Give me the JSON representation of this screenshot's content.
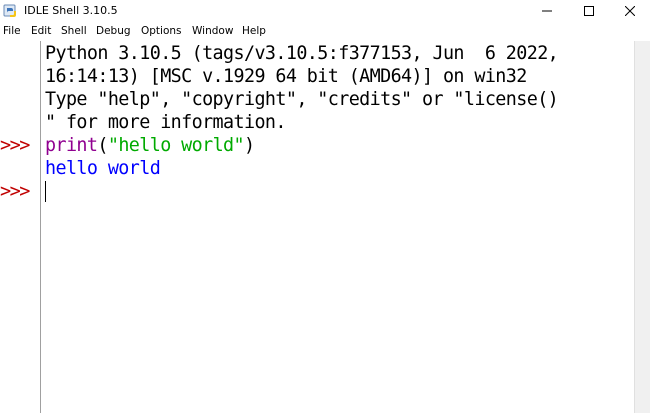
{
  "window": {
    "title": "IDLE Shell 3.10.5",
    "minimize_glyph": "—",
    "maximize_glyph": "☐",
    "close_glyph": "✕"
  },
  "menu": {
    "items": [
      {
        "label": "File",
        "accel": "F"
      },
      {
        "label": "Edit",
        "accel": "E"
      },
      {
        "label": "Shell",
        "accel": "S"
      },
      {
        "label": "Debug",
        "accel": "D"
      },
      {
        "label": "Options",
        "accel": "O"
      },
      {
        "label": "Window",
        "accel": "W"
      },
      {
        "label": "Help",
        "accel": "H"
      }
    ]
  },
  "shell": {
    "prompt": ">>>",
    "banner": [
      "Python 3.10.5 (tags/v3.10.5:f377153, Jun  6 2022,",
      "16:14:13) [MSC v.1929 64 bit (AMD64)] on win32",
      "Type \"help\", \"copyright\", \"credits\" or \"license()",
      "\" for more information."
    ],
    "command": {
      "builtin": "print",
      "open_paren": "(",
      "string": "\"hello world\"",
      "close_paren": ")"
    },
    "output": "hello world"
  },
  "colors": {
    "prompt": "#c00000",
    "builtin": "#900090",
    "string": "#00aa00",
    "stdout": "#0000ff"
  },
  "icons": {
    "app": "idle-python-icon"
  }
}
